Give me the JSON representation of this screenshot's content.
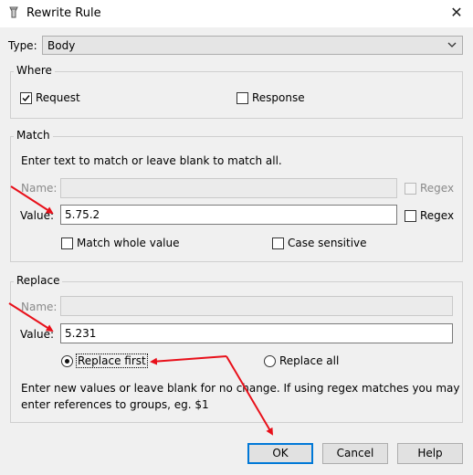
{
  "window": {
    "title": "Rewrite Rule",
    "close_glyph": "✕"
  },
  "type_field": {
    "label": "Type:",
    "value": "Body"
  },
  "where": {
    "legend": "Where",
    "request_label": "Request",
    "request_checked": true,
    "response_label": "Response",
    "response_checked": false
  },
  "match": {
    "legend": "Match",
    "instruction": "Enter text to match or leave blank to match all.",
    "name_label": "Name:",
    "name_value": "",
    "name_regex_label": "Regex",
    "value_label": "Value:",
    "value_value": "5.75.2",
    "value_regex_label": "Regex",
    "whole_value_label": "Match whole value",
    "case_sensitive_label": "Case sensitive"
  },
  "replace": {
    "legend": "Replace",
    "name_label": "Name:",
    "name_value": "",
    "value_label": "Value:",
    "value_value": "5.231",
    "replace_first_label": "Replace first",
    "replace_first_selected": true,
    "replace_all_label": "Replace all",
    "help_line1": "Enter new values or leave blank for no change. If using regex matches you may",
    "help_line2": "enter references to groups, eg. $1"
  },
  "buttons": {
    "ok": "OK",
    "cancel": "Cancel",
    "help": "Help"
  },
  "annotation_color": "#e8101a"
}
